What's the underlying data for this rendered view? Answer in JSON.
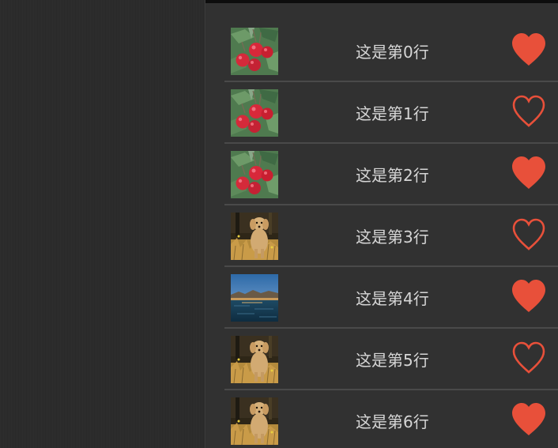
{
  "list": {
    "items": [
      {
        "label": "这是第0行",
        "image": "apples",
        "favorited": true
      },
      {
        "label": "这是第1行",
        "image": "apples",
        "favorited": false
      },
      {
        "label": "这是第2行",
        "image": "apples",
        "favorited": true
      },
      {
        "label": "这是第3行",
        "image": "puppy",
        "favorited": false
      },
      {
        "label": "这是第4行",
        "image": "lake-landscape",
        "favorited": true
      },
      {
        "label": "这是第5行",
        "image": "puppy",
        "favorited": false
      },
      {
        "label": "这是第6行",
        "image": "puppy",
        "favorited": true
      }
    ]
  },
  "colors": {
    "heart": "#e8503a",
    "background_left": "#2a2a2a",
    "background_right": "#313131",
    "separator": "#4a4a4a",
    "text": "#d6d6d6"
  }
}
